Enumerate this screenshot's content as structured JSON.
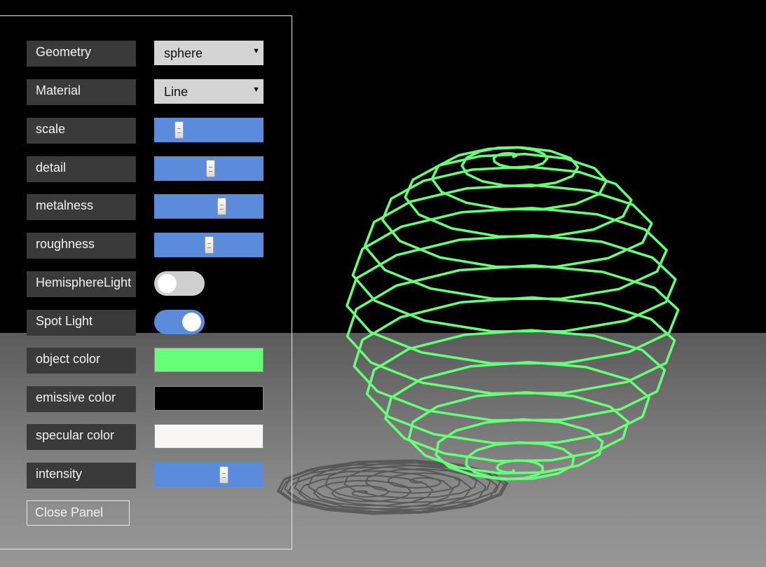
{
  "colors": {
    "object_color": "#66ff77",
    "emissive_color": "#000000",
    "specular_color": "#f8f5f5",
    "slider_accent": "#5b8bdb"
  },
  "panel": {
    "geometry": {
      "label": "Geometry",
      "value": "sphere"
    },
    "material": {
      "label": "Material",
      "value": "Line"
    },
    "scale": {
      "label": "scale",
      "value": 0.2
    },
    "detail": {
      "label": "detail",
      "value": 0.52
    },
    "metalness": {
      "label": "metalness",
      "value": 0.63
    },
    "roughness": {
      "label": "roughness",
      "value": 0.5
    },
    "hemisphere_light": {
      "label": "HemisphereLight",
      "on": false
    },
    "spot_light": {
      "label": "Spot Light",
      "on": true
    },
    "object_color": {
      "label": "object color"
    },
    "emissive_color": {
      "label": "emissive color"
    },
    "specular_color": {
      "label": "specular color"
    },
    "intensity": {
      "label": "intensity",
      "value": 0.65
    },
    "close_label": "Close Panel"
  },
  "icons": {
    "dropdown": "caret-down-icon",
    "slider_thumb": "grip-icon"
  },
  "scene": {
    "object": "sphere-wireframe",
    "shadow": "sphere-shadow",
    "floor": "ground-plane"
  }
}
